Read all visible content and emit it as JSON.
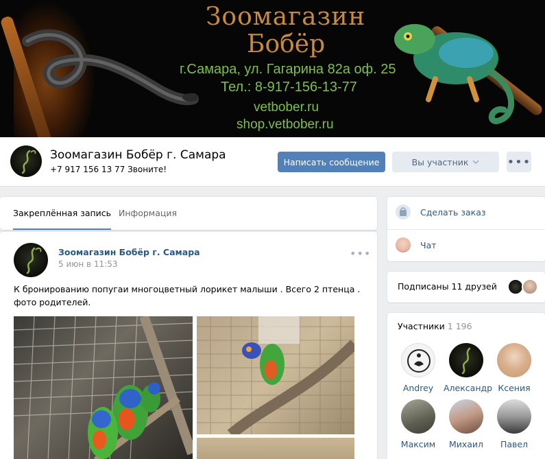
{
  "cover": {
    "title_line1": "Зоомагазин",
    "title_line2": "Бобёр",
    "address": "г.Самара, ул. Гагарина 82а оф. 25",
    "phone": "Тел.: 8-917-156-13-77",
    "site1": "vetbober.ru",
    "site2": "shop.vetbober.ru",
    "colors": {
      "title": "#c98a3a",
      "text": "#7ec04a"
    }
  },
  "header": {
    "title": "Зоомагазин Бобёр г. Самара",
    "status": "+7 917 156 13 77 Звоните!",
    "write_button": "Написать сообщение",
    "member_button": "Вы участник",
    "more_button": "•••"
  },
  "tabs": {
    "pinned": "Закреплённая запись",
    "info": "Информация"
  },
  "post": {
    "author": "Зоомагазин Бобёр г. Самара",
    "date": "5 июн в 11:53",
    "menu": "•••",
    "text": "К бронированию попугаи многоцветный лорикет малыши . Всего 2 птенца . фото родителей."
  },
  "actions": {
    "order": "Сделать заказ",
    "chat": "Чат"
  },
  "friends": {
    "label": "Подписаны 11 друзей"
  },
  "members": {
    "title": "Участники",
    "count": "1 196",
    "list": [
      {
        "name": "Andrey"
      },
      {
        "name": "Александр"
      },
      {
        "name": "Ксения"
      },
      {
        "name": "Максим"
      },
      {
        "name": "Михаил"
      },
      {
        "name": "Павел"
      }
    ]
  },
  "colors": {
    "accent": "#5181b8",
    "link": "#2a5885",
    "bg": "#edeef0"
  }
}
